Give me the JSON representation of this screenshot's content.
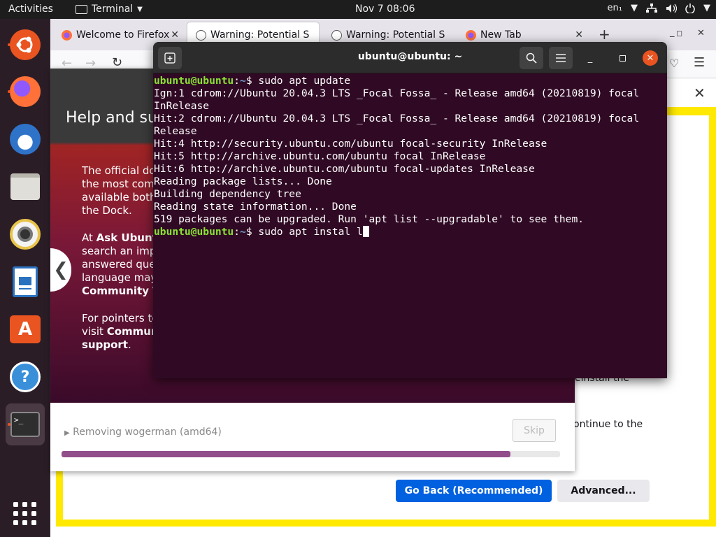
{
  "topbar": {
    "activities": "Activities",
    "app_name": "Terminal",
    "clock": "Nov 7  08:06",
    "lang": "en₁"
  },
  "dock": {
    "apps": [
      {
        "name": "ubuntu-logo",
        "color": "#e95420"
      },
      {
        "name": "Firefox",
        "color": "#ff7139"
      },
      {
        "name": "Thunderbird",
        "color": "#2f73c9"
      },
      {
        "name": "Files",
        "color": "#d8d6d0"
      },
      {
        "name": "Rhythmbox",
        "color": "#e8c44a"
      },
      {
        "name": "LibreOffice Writer",
        "color": "#2a72c0"
      },
      {
        "name": "Ubuntu Software",
        "color": "#e95420"
      },
      {
        "name": "Help",
        "color": "#3a8fd9"
      },
      {
        "name": "Terminal",
        "color": "#303030"
      }
    ]
  },
  "firefox": {
    "tabs": [
      {
        "label": "Welcome to Firefox"
      },
      {
        "label": "Warning: Potential S"
      },
      {
        "label": "Warning: Potential S"
      },
      {
        "label": "New Tab"
      }
    ],
    "page_text_1": "einstall the",
    "page_text_2": "ontinue to the",
    "btn_back": "Go Back (Recommended)",
    "btn_advanced": "Advanced..."
  },
  "installer": {
    "title": "Help and su",
    "p1": [
      "The official do",
      "the most comm",
      "available both",
      "the Dock."
    ],
    "p2_prefix": "At ",
    "p2_bold": "Ask Ubunt",
    "p2": [
      "search an impr",
      "answered que",
      "language may"
    ],
    "p2_bold2": "Community T",
    "p3": [
      "For pointers to",
      "visit "
    ],
    "p3_bold": "Communi",
    "p3_bold2": "support",
    "status": "Removing wogerman (amd64)",
    "skip": "Skip",
    "progress": 0.9
  },
  "terminal": {
    "title": "ubuntu@ubuntu: ~",
    "prompt_user": "ubuntu@ubuntu",
    "prompt_path": "~",
    "cmd1": "sudo apt update",
    "output": [
      "Ign:1 cdrom://Ubuntu 20.04.3 LTS _Focal Fossa_ - Release amd64 (20210819) focal",
      "InRelease",
      "Hit:2 cdrom://Ubuntu 20.04.3 LTS _Focal Fossa_ - Release amd64 (20210819) focal",
      "Release",
      "Hit:4 http://security.ubuntu.com/ubuntu focal-security InRelease",
      "Hit:5 http://archive.ubuntu.com/ubuntu focal InRelease",
      "Hit:6 http://archive.ubuntu.com/ubuntu focal-updates InRelease",
      "Reading package lists... Done",
      "Building dependency tree",
      "Reading state information... Done",
      "519 packages can be upgraded. Run 'apt list --upgradable' to see them."
    ],
    "cmd2": "sudo apt instal l"
  }
}
